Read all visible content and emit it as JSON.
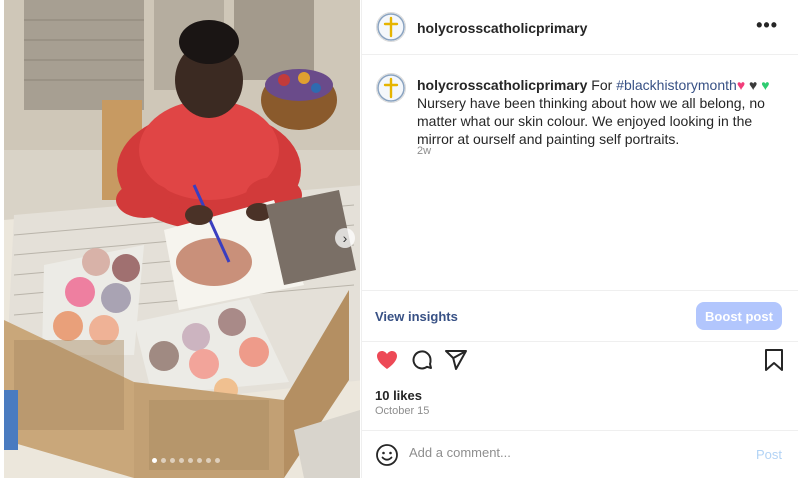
{
  "account": {
    "username": "holycrosscatholicprimary"
  },
  "header": {
    "more_label": "•••"
  },
  "caption": {
    "username": "holycrosscatholicprimary",
    "before": "For ",
    "hashtag": "#blackhistorymonth",
    "hearts": "♥ ♥ ♥",
    "text": " Nursery have been thinking about how we all belong, no matter what our skin colour. We enjoyed looking in the mirror at ourself and painting self portraits.",
    "time_ago": "2w"
  },
  "insights": {
    "view_label": "View insights",
    "boost_label": "Boost post"
  },
  "actions": {
    "like_icon": "heart-filled-icon",
    "comment_icon": "comment-icon",
    "share_icon": "share-icon",
    "save_icon": "bookmark-icon"
  },
  "stats": {
    "likes": "10 likes",
    "date": "October 15"
  },
  "comment": {
    "placeholder": "Add a comment...",
    "post_label": "Post"
  },
  "carousel": {
    "slides": 8,
    "active": 1,
    "next_label": "›"
  },
  "colors": {
    "heart_red": "#ed4956",
    "heart_pink": "#f23d7a",
    "heart_black": "#3a3a3a",
    "heart_green": "#2ecc71",
    "link": "#385185",
    "boost_bg": "#b2c6fd"
  }
}
